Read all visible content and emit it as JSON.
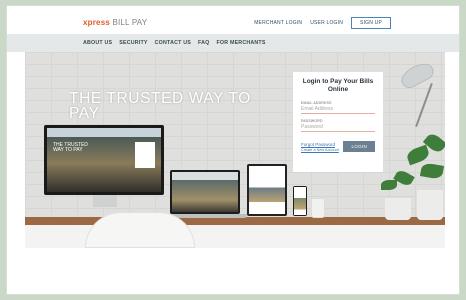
{
  "header": {
    "logo_brand": "xpress",
    "logo_rest": "BILL PAY",
    "links": [
      "MERCHANT LOGIN",
      "USER LOGIN"
    ],
    "signup_label": "SIGN UP"
  },
  "nav": {
    "items": [
      "ABOUT US",
      "SECURITY",
      "CONTACT US",
      "FAQ",
      "FOR MERCHANTS"
    ]
  },
  "hero": {
    "title": "THE TRUSTED WAY TO PAY"
  },
  "login": {
    "heading": "Login to Pay Your Bills Online",
    "email_label": "EMAIL ADDRESS",
    "email_placeholder": "Email Address",
    "password_label": "PASSWORD",
    "password_placeholder": "Password",
    "forgot_label": "Forgot Password",
    "create_label": "Create a New Account",
    "button_label": "LOGIN"
  },
  "screen": {
    "monitor_title": "THE TRUSTED WAY TO PAY"
  },
  "colors": {
    "brand": "#e05a2b",
    "link": "#3a76b8",
    "button": "#6b8193",
    "page_bg": "#c9d8c7"
  }
}
